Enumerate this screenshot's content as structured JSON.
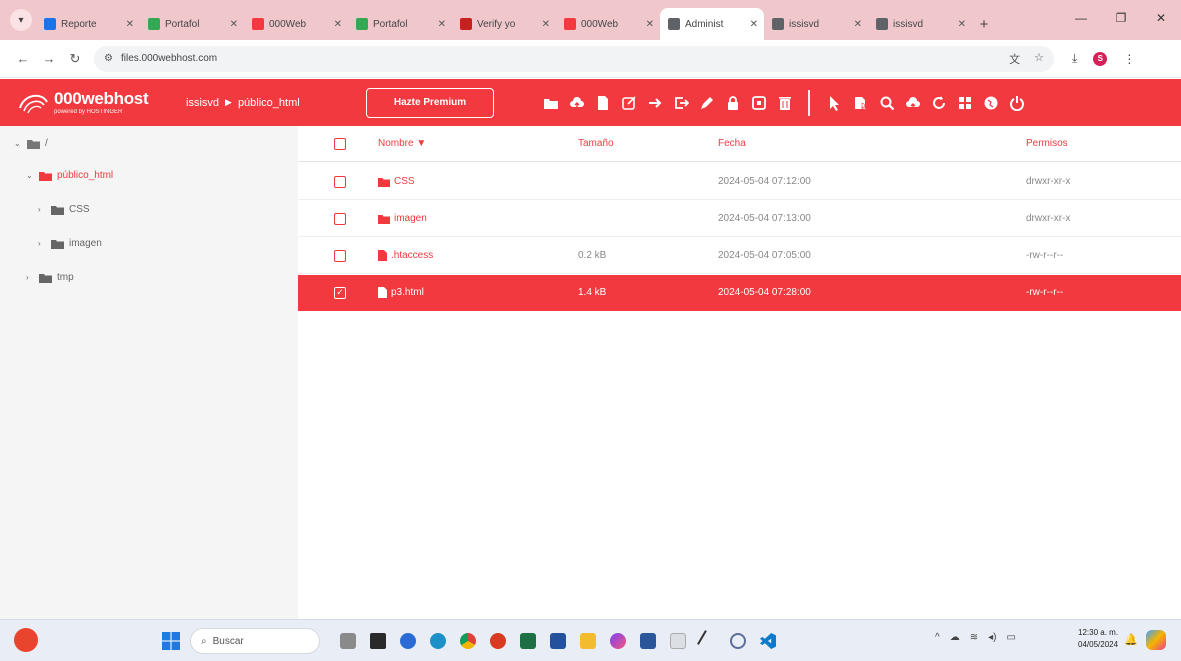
{
  "browser": {
    "tabs": [
      {
        "title": "Reporte",
        "favicon_color": "#1a73e8",
        "active": false
      },
      {
        "title": "Portafol",
        "favicon_color": "#34a853",
        "active": false
      },
      {
        "title": "000Web",
        "favicon_color": "#f1393f",
        "active": false
      },
      {
        "title": "Portafol",
        "favicon_color": "#34a853",
        "active": false
      },
      {
        "title": "Verify yo",
        "favicon_color": "#c5221f",
        "active": false
      },
      {
        "title": "000Web",
        "favicon_color": "#f1393f",
        "active": false
      },
      {
        "title": "Administ",
        "favicon_color": "#5f6368",
        "active": true
      },
      {
        "title": "issisvd",
        "favicon_color": "#5f6368",
        "active": false
      },
      {
        "title": "issisvd",
        "favicon_color": "#5f6368",
        "active": false
      }
    ],
    "address": {
      "url": "files.000webhost.com"
    },
    "profile_initial": "S"
  },
  "header": {
    "logo_main": "000webhost",
    "logo_sub": "powered by HOSTINGER",
    "breadcrumb": [
      "issisvd",
      "público_html"
    ],
    "premium_label": "Hazte Premium",
    "brand_color": "#f1393f"
  },
  "sidebar": {
    "root_label": "/",
    "items": [
      {
        "label": "público_html",
        "level": 1,
        "expanded": true,
        "active": true
      },
      {
        "label": "CSS",
        "level": 2,
        "expanded": false,
        "active": false
      },
      {
        "label": "imagen",
        "level": 2,
        "expanded": false,
        "active": false
      },
      {
        "label": "tmp",
        "level": 1,
        "expanded": false,
        "active": false
      }
    ]
  },
  "filelist": {
    "columns": {
      "name": "Nombre ▼",
      "size": "Tamaño",
      "date": "Fecha",
      "perm": "Permisos"
    },
    "rows": [
      {
        "name": "CSS",
        "type": "folder",
        "size": "",
        "date": "2024-05-04 07:12:00",
        "perm": "drwxr-xr-x",
        "selected": false
      },
      {
        "name": "imagen",
        "type": "folder",
        "size": "",
        "date": "2024-05-04 07:13:00",
        "perm": "drwxr-xr-x",
        "selected": false
      },
      {
        "name": ".htaccess",
        "type": "file",
        "size": "0.2 kB",
        "date": "2024-05-04 07:05:00",
        "perm": "-rw-r--r--",
        "selected": false
      },
      {
        "name": "p3.html",
        "type": "file",
        "size": "1.4 kB",
        "date": "2024-05-04 07:28:00",
        "perm": "-rw-r--r--",
        "selected": true
      }
    ]
  },
  "taskbar": {
    "search_placeholder": "Buscar",
    "time": "12:30 a. m.",
    "date": "04/05/2024"
  }
}
